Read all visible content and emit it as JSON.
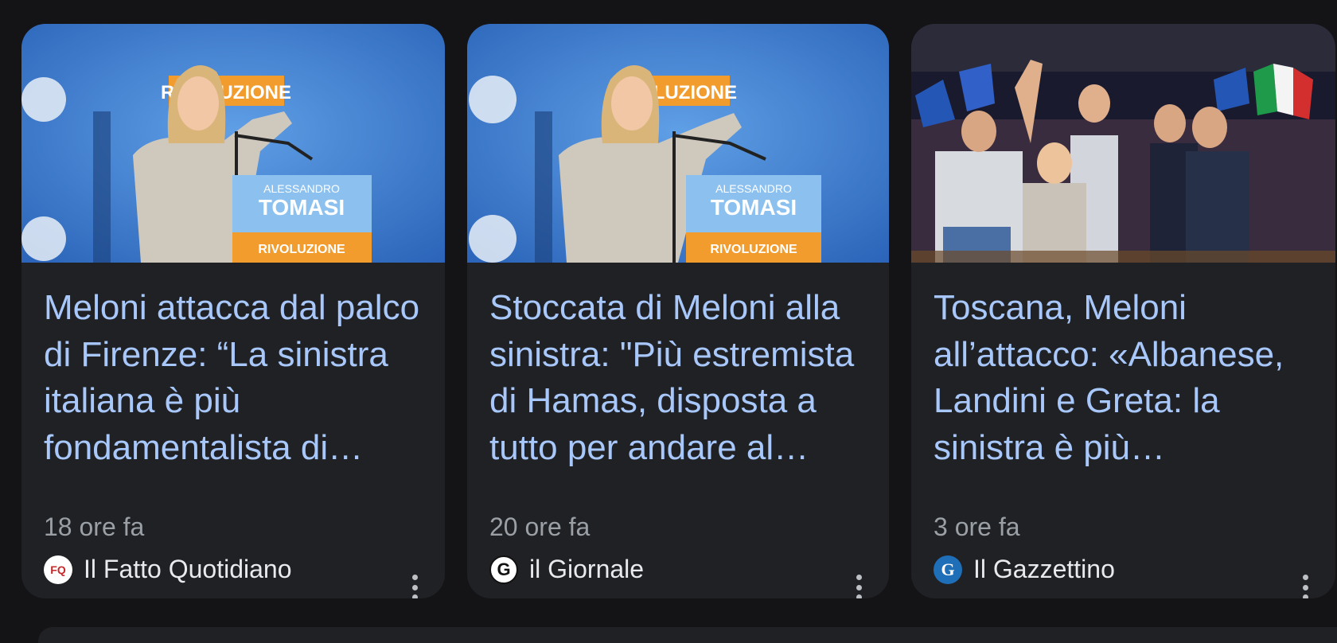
{
  "cards": [
    {
      "title": "Meloni attacca dal palco di Firenze: “La sinistra italiana è più fondamentalista di Hamas”",
      "time": "18 ore fa",
      "source": "Il Fatto Quotidiano",
      "logo_text": "FQ",
      "image_text": {
        "banner": "RIVOLUZIONE",
        "podium_top": "ALESSANDRO",
        "podium_name": "TOMASI",
        "podium_footer": "RIVOLUZIONE"
      }
    },
    {
      "title": "Stoccata di Meloni alla sinistra: \"Più estremista di Hamas, disposta a tutto per andare al potere\"",
      "time": "20 ore fa",
      "source": "il Giornale",
      "logo_text": "G",
      "image_text": {
        "banner": "RIVOLUZIONE",
        "podium_top": "ALESSANDRO",
        "podium_name": "TOMASI",
        "podium_footer": "RIVOLUZIONE"
      }
    },
    {
      "title": "Toscana, Meloni all’attacco: «Albanese, Landini e Greta: la sinistra è più fondamentalista di Hamas»",
      "time": "3 ore fa",
      "source": "Il Gazzettino",
      "logo_text": "G"
    }
  ],
  "colors": {
    "page_bg": "#141416",
    "card_bg": "#202124",
    "title": "#a8c7fa",
    "meta": "#9aa0a6",
    "source": "#e8eaed"
  },
  "icons": {
    "more": "more-vert-icon"
  }
}
